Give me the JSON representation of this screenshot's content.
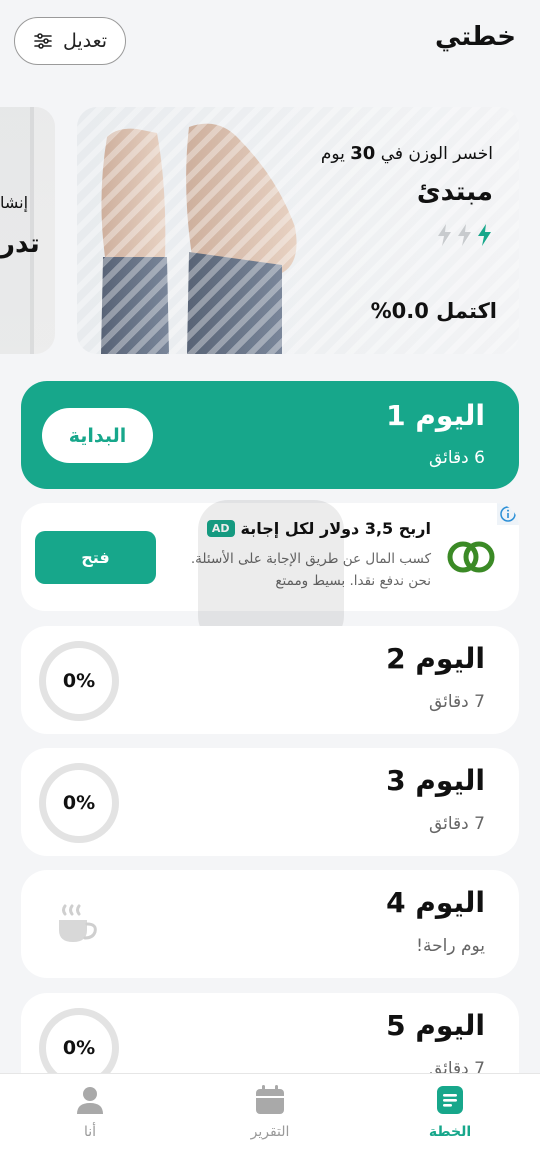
{
  "header": {
    "title": "خطتي",
    "edit_label": "تعديل"
  },
  "hero": {
    "goal_prefix": "اخسر الوزن في",
    "goal_days": "30",
    "goal_suffix": "يوم",
    "level": "مبتدئ",
    "progress_text": "اكتمل 0.0%",
    "active_bolts": 1,
    "total_bolts": 3
  },
  "next_plan_peek": {
    "line1": "إنشا",
    "line2": "تدر"
  },
  "day1": {
    "title": "اليوم 1",
    "duration": "6 دقائق",
    "start_label": "البداية"
  },
  "ad": {
    "badge": "AD",
    "title": "اربح 3,5 دولار لكل إجابة",
    "line1": "كسب المال عن طريق الإجابة على الأسئلة.",
    "line2": "نحن ندفع نقدا. بسيط وممتع",
    "open_label": "فتح"
  },
  "days": [
    {
      "title": "اليوم 2",
      "sub": "7 دقائق",
      "progress": "0%",
      "rest": false
    },
    {
      "title": "اليوم 3",
      "sub": "7 دقائق",
      "progress": "0%",
      "rest": false
    },
    {
      "title": "اليوم 4",
      "sub": "يوم راحة!",
      "progress": "",
      "rest": true
    },
    {
      "title": "اليوم 5",
      "sub": "7 دقائق",
      "progress": "0%",
      "rest": false
    }
  ],
  "nav": {
    "plan": "الخطة",
    "report": "التقرير",
    "me": "أنا"
  },
  "colors": {
    "accent": "#17a78b",
    "background": "#f4f5f7",
    "inactive": "#9a9a9a"
  }
}
